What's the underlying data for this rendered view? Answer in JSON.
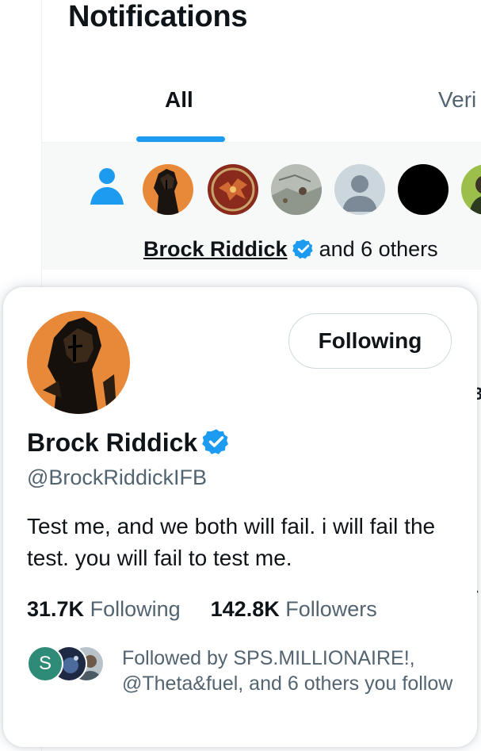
{
  "header": {
    "title": "Notifications"
  },
  "tabs": [
    {
      "label": "All",
      "active": true
    },
    {
      "label": "Veri",
      "active": false
    }
  ],
  "notification": {
    "name": "Brock Riddick",
    "suffix": "and 6 others"
  },
  "hover_card": {
    "name": "Brock Riddick",
    "handle": "@BrockRiddickIFB",
    "bio": "Test me, and we both will fail. i will fail the test. you will fail to test me.",
    "follow_button": "Following",
    "following_count": "31.7K",
    "following_label": "Following",
    "followers_count": "142.8K",
    "followers_label": "Followers",
    "followed_by_initial": "S",
    "followed_by_text": "Followed by SPS.MILLIONAIRE!, @Theta&fuel, and 6 others you follow"
  },
  "colors": {
    "accent": "#1d9bf0",
    "text_primary": "#0f1419",
    "text_secondary": "#536471",
    "avatar_orange": "#e8893a",
    "followed_avatar_green": "#2e8b78"
  },
  "icons": [
    "person-icon",
    "verified-badge-icon"
  ]
}
